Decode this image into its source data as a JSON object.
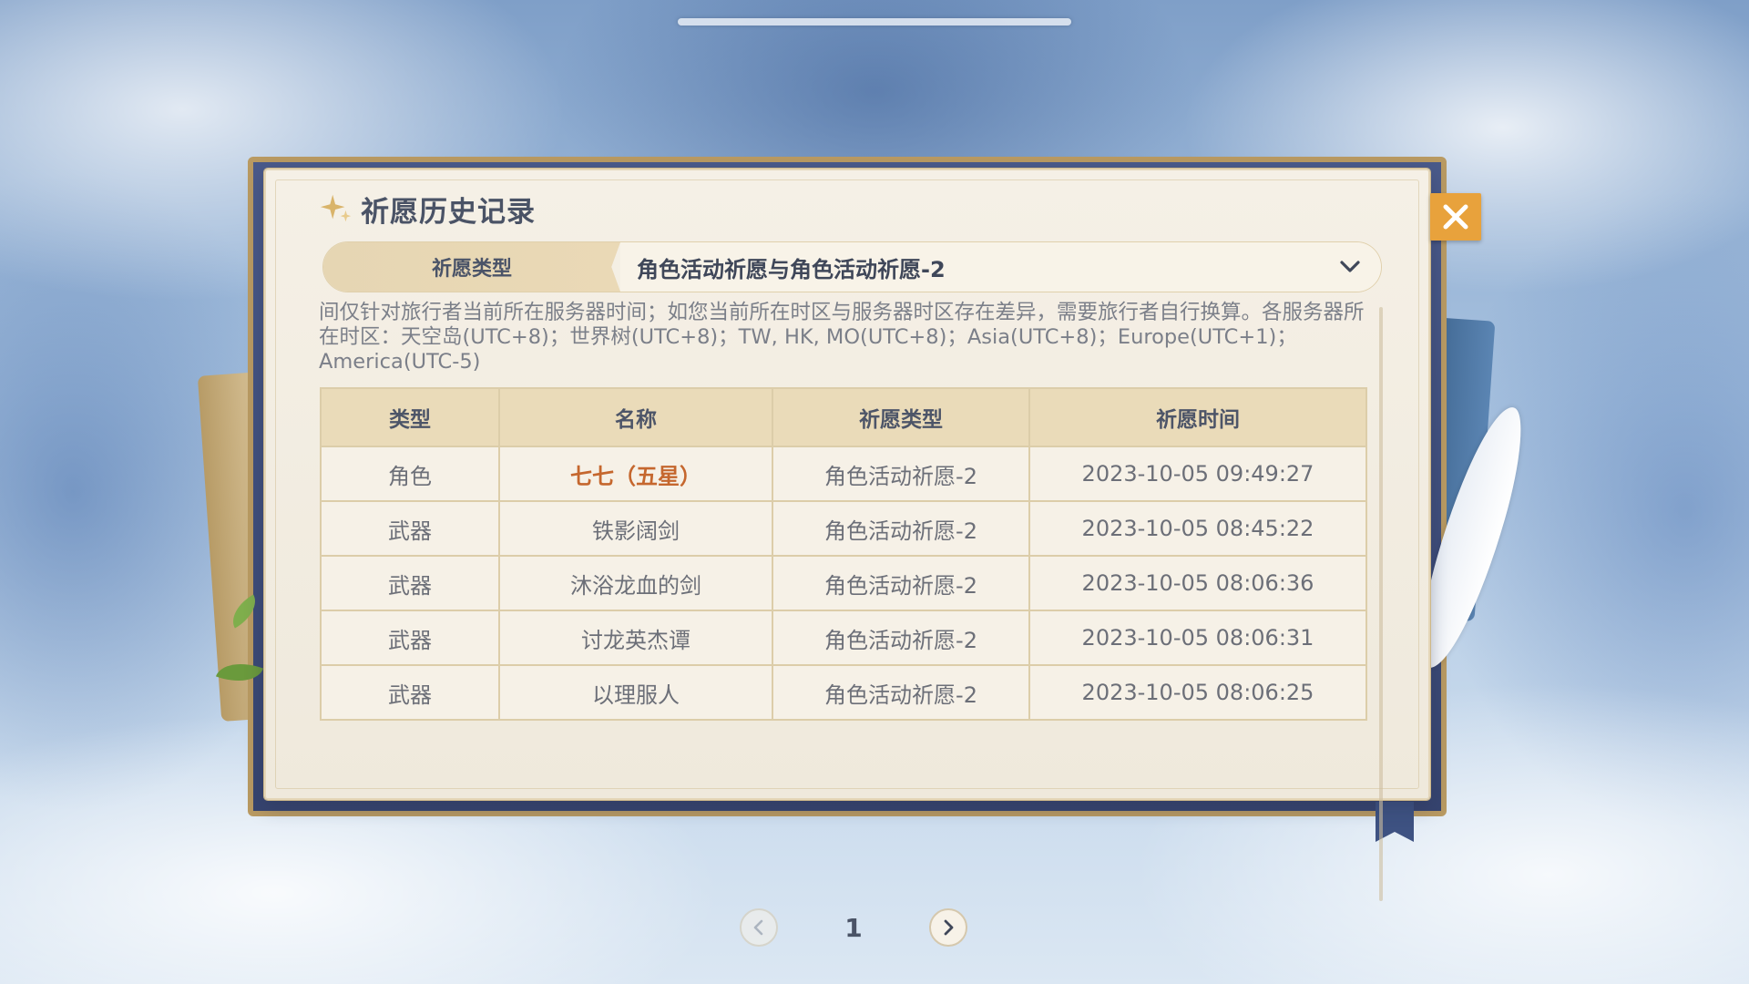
{
  "dialog": {
    "title": "祈愿历史记录",
    "close_icon": "close-icon",
    "title_icon": "sparkle-star-icon"
  },
  "filter": {
    "label": "祈愿类型",
    "selected": "角色活动祈愿与角色活动祈愿-2",
    "dropdown_icon": "chevron-down-icon"
  },
  "notice": "间仅针对旅行者当前所在服务器时间；如您当前所在时区与服务器时区存在差异，需要旅行者自行换算。各服务器所在时区：天空岛(UTC+8)；世界树(UTC+8)；TW, HK, MO(UTC+8)；Asia(UTC+8)；Europe(UTC+1)；America(UTC-5)",
  "table": {
    "headers": [
      "类型",
      "名称",
      "祈愿类型",
      "祈愿时间"
    ],
    "rows": [
      {
        "type": "角色",
        "name": "七七（五星）",
        "wish_type": "角色活动祈愿-2",
        "time": "2023-10-05 09:49:27",
        "highlight": true
      },
      {
        "type": "武器",
        "name": "铁影阔剑",
        "wish_type": "角色活动祈愿-2",
        "time": "2023-10-05 08:45:22",
        "highlight": false
      },
      {
        "type": "武器",
        "name": "沐浴龙血的剑",
        "wish_type": "角色活动祈愿-2",
        "time": "2023-10-05 08:06:36",
        "highlight": false
      },
      {
        "type": "武器",
        "name": "讨龙英杰谭",
        "wish_type": "角色活动祈愿-2",
        "time": "2023-10-05 08:06:31",
        "highlight": false
      },
      {
        "type": "武器",
        "name": "以理服人",
        "wish_type": "角色活动祈愿-2",
        "time": "2023-10-05 08:06:25",
        "highlight": false
      }
    ]
  },
  "pagination": {
    "current_page": "1",
    "prev_icon": "chevron-left-icon",
    "next_icon": "chevron-right-icon"
  },
  "colors": {
    "five_star_text": "#c5672e",
    "close_button": "#e8a23c",
    "header_bg": "#eadbb9"
  }
}
